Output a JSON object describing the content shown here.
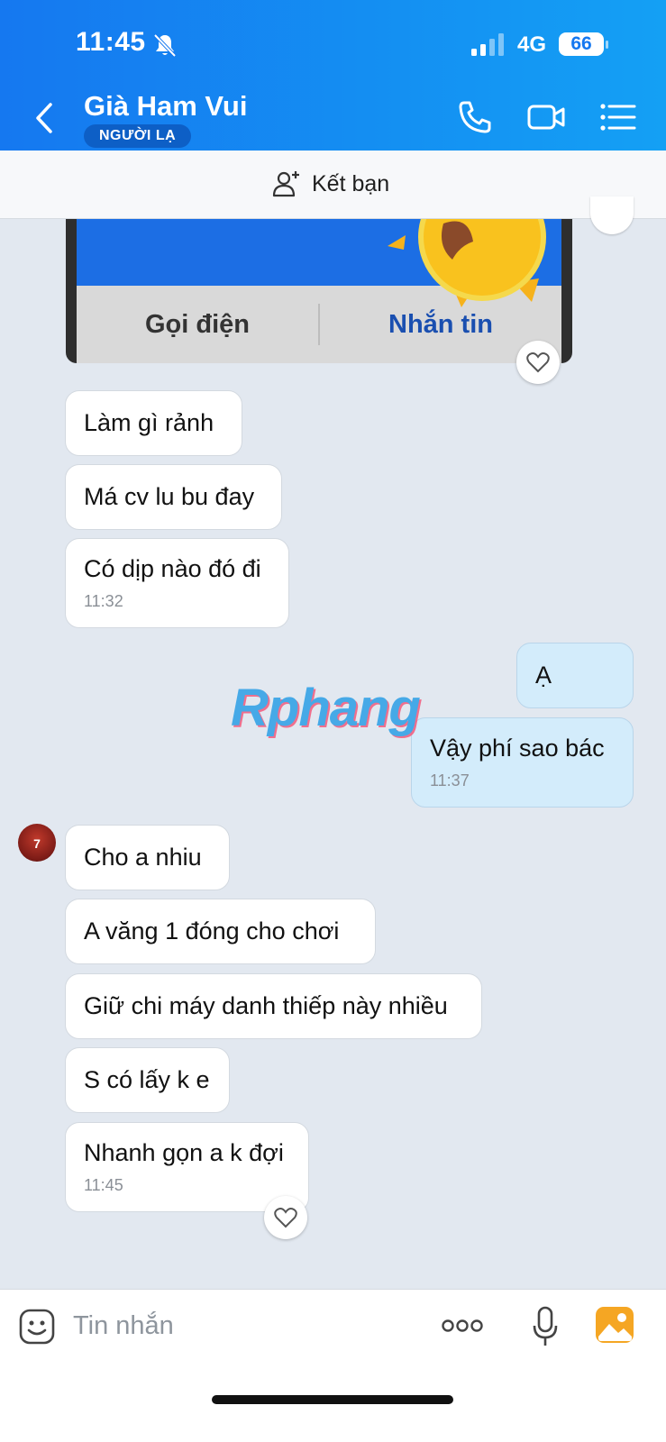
{
  "status_bar": {
    "time": "11:45",
    "network": "4G",
    "battery": "66"
  },
  "header": {
    "contact_name": "Già Ham Vui",
    "badge": "NGƯỜI LẠ"
  },
  "friend_bar": {
    "label": "Kết bạn"
  },
  "card": {
    "call_label": "Gọi điện",
    "message_label": "Nhắn tin"
  },
  "watermark": "Rphang",
  "messages": [
    {
      "text": "Làm gì rảnh",
      "time": ""
    },
    {
      "text": "Má cv lu bu đay",
      "time": ""
    },
    {
      "text": "Có dịp nào đó đi",
      "time": "11:32"
    },
    {
      "text": "Ạ",
      "time": ""
    },
    {
      "text": "Vậy phí sao bác",
      "time": "11:37"
    },
    {
      "text": "Cho a nhiu",
      "time": ""
    },
    {
      "text": "A văng 1 đóng cho chơi",
      "time": ""
    },
    {
      "text": "Giữ chi máy danh thiếp này nhiều",
      "time": ""
    },
    {
      "text": "S có lấy k e",
      "time": ""
    },
    {
      "text": "Nhanh gọn a k đợi",
      "time": "11:45"
    }
  ],
  "avatar_jersey": "7",
  "input": {
    "placeholder": "Tin nhắn"
  },
  "colors": {
    "header_start": "#1578f0",
    "header_end": "#14a0f4",
    "outgoing_bubble": "#d3ecfb",
    "background": "#e2e8f0"
  }
}
